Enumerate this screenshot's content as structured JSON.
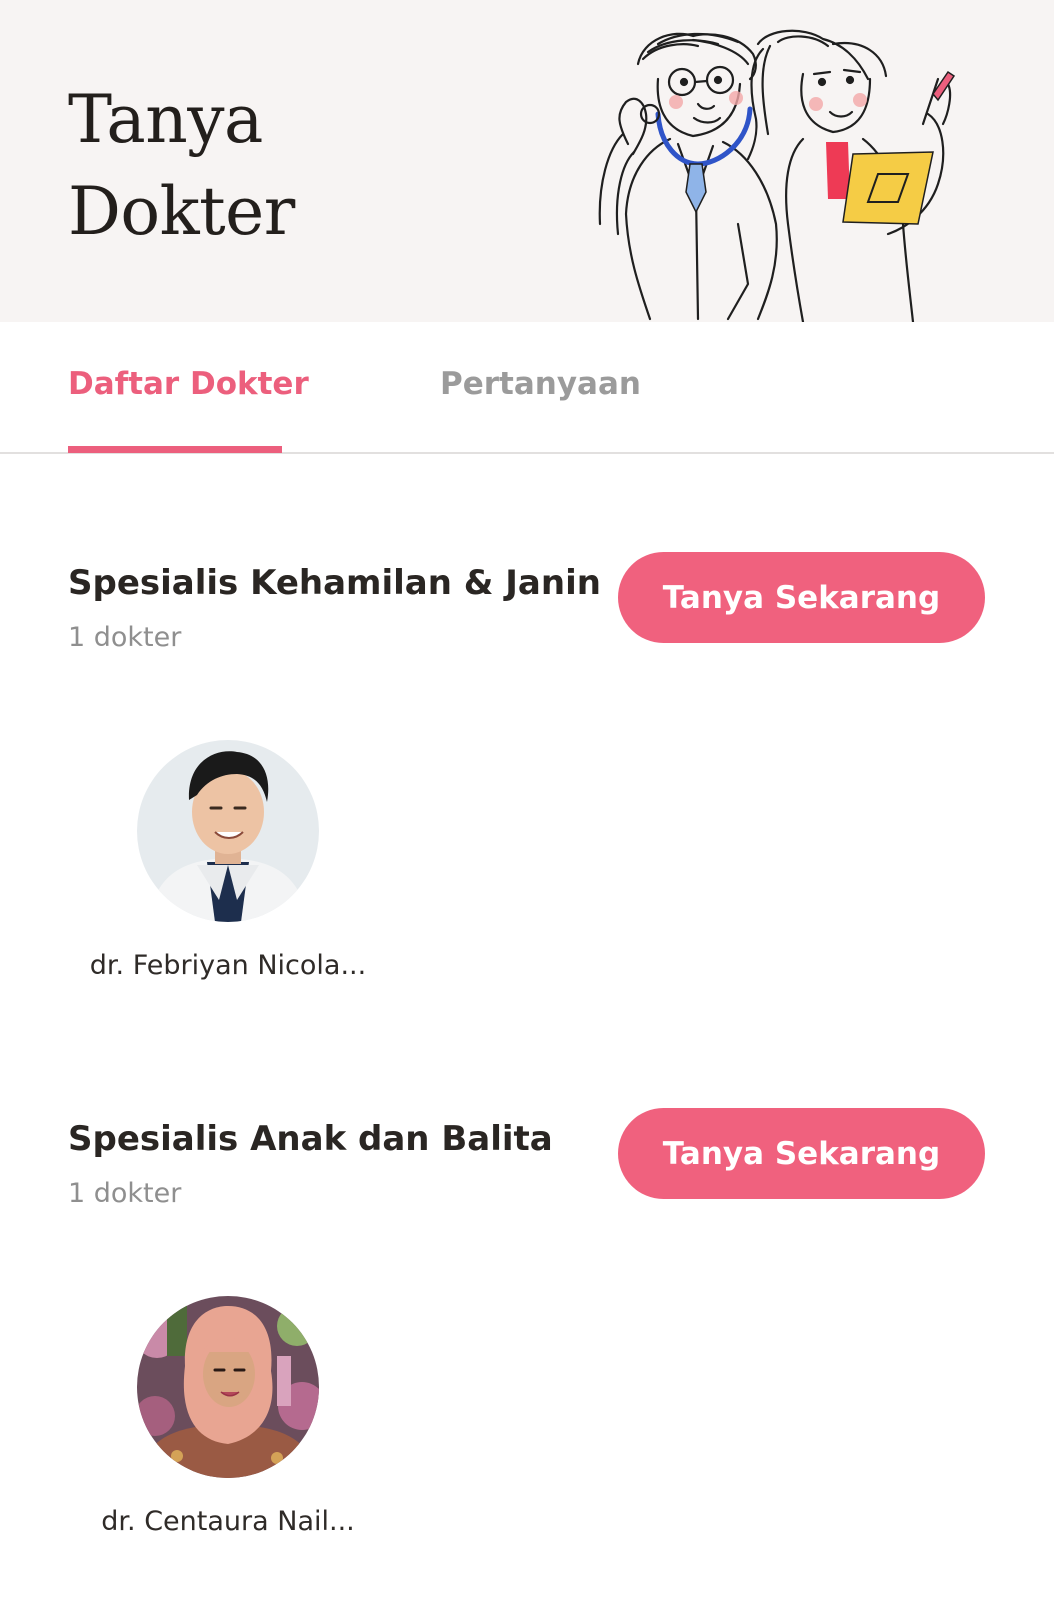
{
  "header": {
    "title_line1": "Tanya",
    "title_line2": "Dokter",
    "illustration": "doctors-illustration"
  },
  "tabs": [
    {
      "label": "Daftar Dokter",
      "active": true
    },
    {
      "label": "Pertanyaan",
      "active": false
    }
  ],
  "sections": [
    {
      "title": "Spesialis Kehamilan & Janin",
      "count": "1 dokter",
      "button_label": "Tanya Sekarang",
      "doctors": [
        {
          "name": "dr. Febriyan Nicola...",
          "avatar": "doctor-male-photo"
        }
      ]
    },
    {
      "title": "Spesialis Anak dan Balita",
      "count": "1 dokter",
      "button_label": "Tanya Sekarang",
      "doctors": [
        {
          "name": "dr. Centaura Nail...",
          "avatar": "doctor-female-hijab-photo"
        }
      ]
    }
  ],
  "colors": {
    "accent": "#f0617e",
    "tab_active": "#ec5f7d",
    "tab_inactive": "#9b9b9b",
    "header_bg": "#f7f4f3",
    "muted_text": "#8f8f8f"
  }
}
